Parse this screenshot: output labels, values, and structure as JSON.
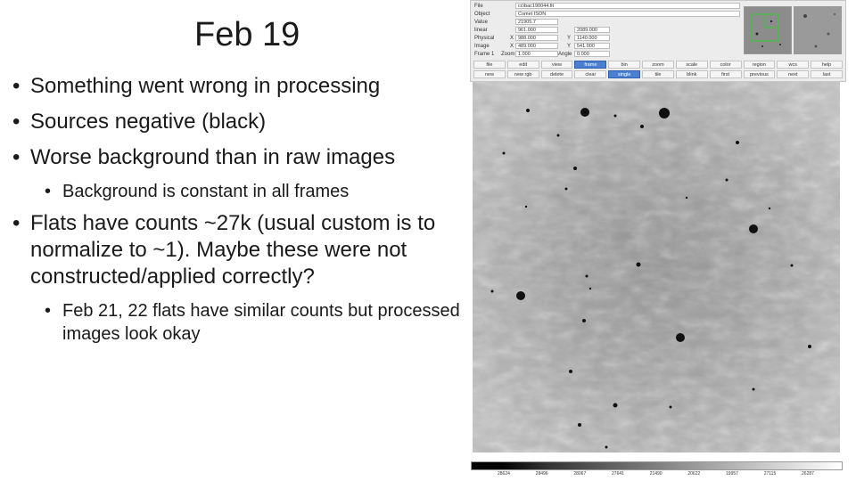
{
  "slide": {
    "title": "Feb 19",
    "bullets": [
      {
        "level": 1,
        "text": "Something went wrong in processing"
      },
      {
        "level": 1,
        "text": "Sources negative (black)"
      },
      {
        "level": 1,
        "text": "Worse background than in raw images"
      },
      {
        "level": 2,
        "text": "Background is constant in all frames"
      },
      {
        "level": 1,
        "text": "Flats have counts ~27k (usual custom is to normalize to ~1). Maybe these were not constructed/applied correctly?"
      },
      {
        "level": 2,
        "text": "Feb 21, 22 flats have similar counts but processed images look okay"
      }
    ]
  },
  "ds9": {
    "info": {
      "file_label": "File",
      "file_value": "cc\\bac190044.fit",
      "object_label": "Object",
      "object_value": "Comet ISON",
      "value_label": "Value",
      "value_value": "21905.7",
      "wcs_label": "linear",
      "wcs_x": "961.000",
      "wcs_y": "2089.000",
      "physical_label": "Physical",
      "physical_x_label": "X",
      "physical_x": "988.000",
      "physical_y_label": "Y",
      "physical_y": "1140.000",
      "image_label": "Image",
      "image_x_label": "X",
      "image_x": "489.000",
      "image_y_label": "Y",
      "image_y": "541.000",
      "frame_label": "Frame 1",
      "zoom_label": "Zoom",
      "zoom_value": "1.000",
      "angle_label": "Angle",
      "angle_value": "0.000"
    },
    "menu_row": [
      "file",
      "edit",
      "view",
      "frame",
      "bin",
      "zoom",
      "scale",
      "color",
      "region",
      "wcs",
      "help"
    ],
    "active_menu": "frame",
    "button_row": [
      "new",
      "new rgb",
      "delete",
      "clear",
      "single",
      "tile",
      "blink",
      "first",
      "previous",
      "next",
      "last"
    ],
    "active_button": "single",
    "colorbar_ticks": [
      "28624",
      "28496",
      "28067",
      "27641",
      "21490",
      "20622",
      "19957",
      "27115",
      "26287"
    ]
  },
  "colors": {
    "active_button": "#4a7fd1",
    "panel_bg": "#ececec"
  }
}
